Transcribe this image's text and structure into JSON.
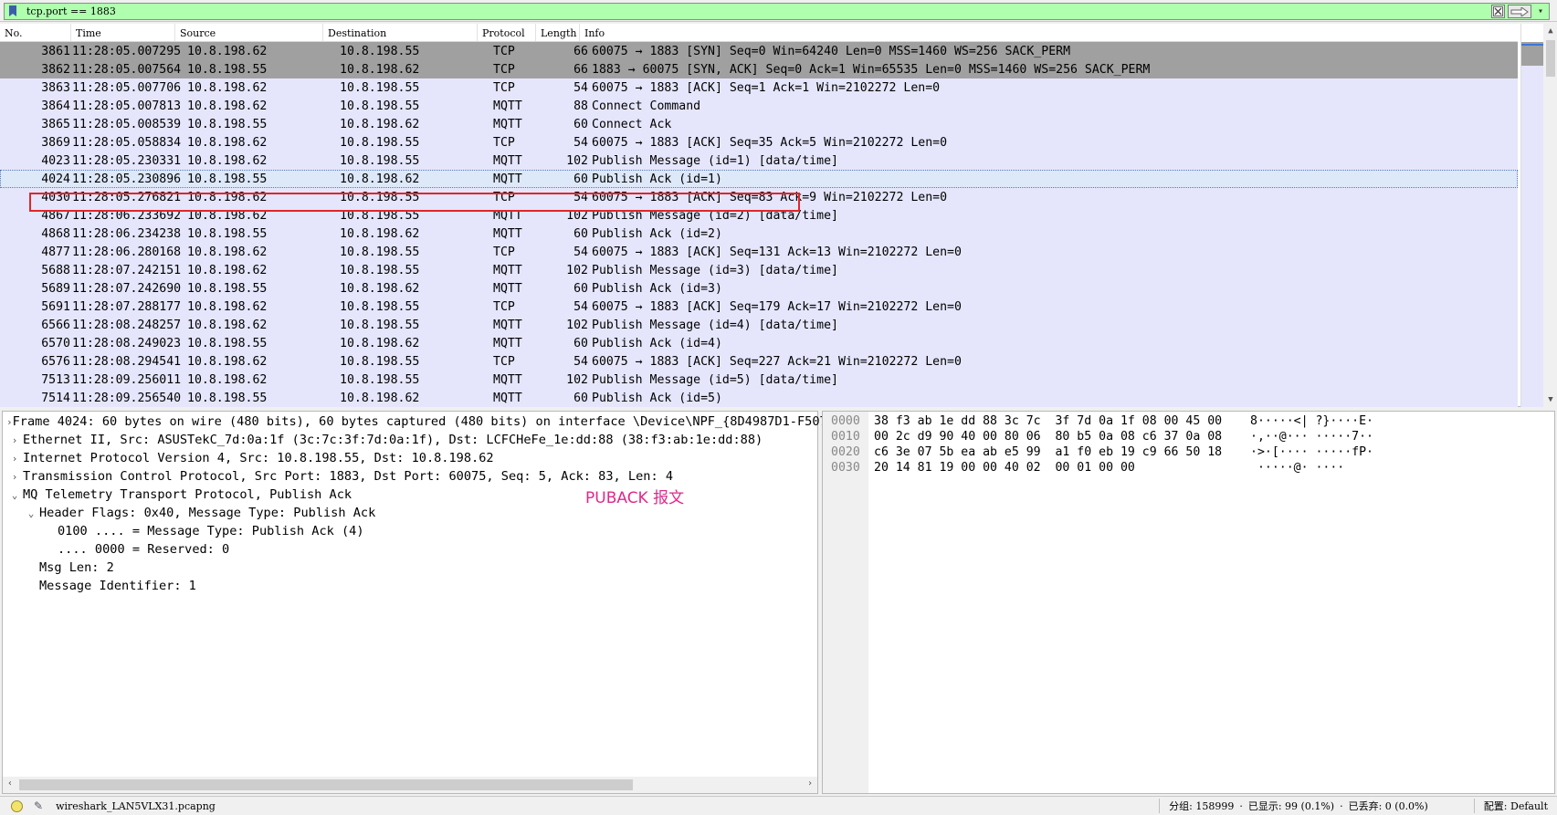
{
  "filter": {
    "value": "tcp.port == 1883"
  },
  "columns": {
    "no": "No.",
    "time": "Time",
    "source": "Source",
    "destination": "Destination",
    "protocol": "Protocol",
    "length": "Length",
    "info": "Info"
  },
  "packets": [
    {
      "no": "3861",
      "time": "11:28:05.007295",
      "src": "10.8.198.62",
      "dst": "10.8.198.55",
      "proto": "TCP",
      "len": "66",
      "info": "60075 → 1883 [SYN] Seq=0 Win=64240 Len=0 MSS=1460 WS=256 SACK_PERM"
    },
    {
      "no": "3862",
      "time": "11:28:05.007564",
      "src": "10.8.198.55",
      "dst": "10.8.198.62",
      "proto": "TCP",
      "len": "66",
      "info": "1883 → 60075 [SYN, ACK] Seq=0 Ack=1 Win=65535 Len=0 MSS=1460 WS=256 SACK_PERM"
    },
    {
      "no": "3863",
      "time": "11:28:05.007706",
      "src": "10.8.198.62",
      "dst": "10.8.198.55",
      "proto": "TCP",
      "len": "54",
      "info": "60075 → 1883 [ACK] Seq=1 Ack=1 Win=2102272 Len=0"
    },
    {
      "no": "3864",
      "time": "11:28:05.007813",
      "src": "10.8.198.62",
      "dst": "10.8.198.55",
      "proto": "MQTT",
      "len": "88",
      "info": "Connect Command"
    },
    {
      "no": "3865",
      "time": "11:28:05.008539",
      "src": "10.8.198.55",
      "dst": "10.8.198.62",
      "proto": "MQTT",
      "len": "60",
      "info": "Connect Ack"
    },
    {
      "no": "3869",
      "time": "11:28:05.058834",
      "src": "10.8.198.62",
      "dst": "10.8.198.55",
      "proto": "TCP",
      "len": "54",
      "info": "60075 → 1883 [ACK] Seq=35 Ack=5 Win=2102272 Len=0"
    },
    {
      "no": "4023",
      "time": "11:28:05.230331",
      "src": "10.8.198.62",
      "dst": "10.8.198.55",
      "proto": "MQTT",
      "len": "102",
      "info": "Publish Message (id=1) [data/time]"
    },
    {
      "no": "4024",
      "time": "11:28:05.230896",
      "src": "10.8.198.55",
      "dst": "10.8.198.62",
      "proto": "MQTT",
      "len": "60",
      "info": "Publish Ack (id=1)"
    },
    {
      "no": "4030",
      "time": "11:28:05.276821",
      "src": "10.8.198.62",
      "dst": "10.8.198.55",
      "proto": "TCP",
      "len": "54",
      "info": "60075 → 1883 [ACK] Seq=83 Ack=9 Win=2102272 Len=0"
    },
    {
      "no": "4867",
      "time": "11:28:06.233692",
      "src": "10.8.198.62",
      "dst": "10.8.198.55",
      "proto": "MQTT",
      "len": "102",
      "info": "Publish Message (id=2) [data/time]"
    },
    {
      "no": "4868",
      "time": "11:28:06.234238",
      "src": "10.8.198.55",
      "dst": "10.8.198.62",
      "proto": "MQTT",
      "len": "60",
      "info": "Publish Ack (id=2)"
    },
    {
      "no": "4877",
      "time": "11:28:06.280168",
      "src": "10.8.198.62",
      "dst": "10.8.198.55",
      "proto": "TCP",
      "len": "54",
      "info": "60075 → 1883 [ACK] Seq=131 Ack=13 Win=2102272 Len=0"
    },
    {
      "no": "5688",
      "time": "11:28:07.242151",
      "src": "10.8.198.62",
      "dst": "10.8.198.55",
      "proto": "MQTT",
      "len": "102",
      "info": "Publish Message (id=3) [data/time]"
    },
    {
      "no": "5689",
      "time": "11:28:07.242690",
      "src": "10.8.198.55",
      "dst": "10.8.198.62",
      "proto": "MQTT",
      "len": "60",
      "info": "Publish Ack (id=3)"
    },
    {
      "no": "5691",
      "time": "11:28:07.288177",
      "src": "10.8.198.62",
      "dst": "10.8.198.55",
      "proto": "TCP",
      "len": "54",
      "info": "60075 → 1883 [ACK] Seq=179 Ack=17 Win=2102272 Len=0"
    },
    {
      "no": "6566",
      "time": "11:28:08.248257",
      "src": "10.8.198.62",
      "dst": "10.8.198.55",
      "proto": "MQTT",
      "len": "102",
      "info": "Publish Message (id=4) [data/time]"
    },
    {
      "no": "6570",
      "time": "11:28:08.249023",
      "src": "10.8.198.55",
      "dst": "10.8.198.62",
      "proto": "MQTT",
      "len": "60",
      "info": "Publish Ack (id=4)"
    },
    {
      "no": "6576",
      "time": "11:28:08.294541",
      "src": "10.8.198.62",
      "dst": "10.8.198.55",
      "proto": "TCP",
      "len": "54",
      "info": "60075 → 1883 [ACK] Seq=227 Ack=21 Win=2102272 Len=0"
    },
    {
      "no": "7513",
      "time": "11:28:09.256011",
      "src": "10.8.198.62",
      "dst": "10.8.198.55",
      "proto": "MQTT",
      "len": "102",
      "info": "Publish Message (id=5) [data/time]"
    },
    {
      "no": "7514",
      "time": "11:28:09.256540",
      "src": "10.8.198.55",
      "dst": "10.8.198.62",
      "proto": "MQTT",
      "len": "60",
      "info": "Publish Ack (id=5)"
    }
  ],
  "selected_packet": "4024",
  "details": [
    {
      "indent": 0,
      "arrow": "›",
      "text": "Frame 4024: 60 bytes on wire (480 bits), 60 bytes captured (480 bits) on interface \\Device\\NPF_{8D4987D1-F507"
    },
    {
      "indent": 0,
      "arrow": "›",
      "text": "Ethernet II, Src: ASUSTekC_7d:0a:1f (3c:7c:3f:7d:0a:1f), Dst: LCFCHeFe_1e:dd:88 (38:f3:ab:1e:dd:88)"
    },
    {
      "indent": 0,
      "arrow": "›",
      "text": "Internet Protocol Version 4, Src: 10.8.198.55, Dst: 10.8.198.62"
    },
    {
      "indent": 0,
      "arrow": "›",
      "text": "Transmission Control Protocol, Src Port: 1883, Dst Port: 60075, Seq: 5, Ack: 83, Len: 4"
    },
    {
      "indent": 0,
      "arrow": "⌄",
      "text": "MQ Telemetry Transport Protocol, Publish Ack"
    },
    {
      "indent": 1,
      "arrow": "⌄",
      "text": "Header Flags: 0x40, Message Type: Publish Ack"
    },
    {
      "indent": 2,
      "arrow": "",
      "text": "0100 .... = Message Type: Publish Ack (4)"
    },
    {
      "indent": 2,
      "arrow": "",
      "text": ".... 0000 = Reserved: 0"
    },
    {
      "indent": 1,
      "arrow": "",
      "text": "Msg Len: 2"
    },
    {
      "indent": 1,
      "arrow": "",
      "text": "Message Identifier: 1"
    }
  ],
  "annotation": "PUBACK 报文",
  "bytes": [
    {
      "off": "0000",
      "hex": "38 f3 ab 1e dd 88 3c 7c  3f 7d 0a 1f 08 00 45 00",
      "asc": "8·····<| ?}····E·"
    },
    {
      "off": "0010",
      "hex": "00 2c d9 90 40 00 80 06  80 b5 0a 08 c6 37 0a 08",
      "asc": "·,··@··· ·····7··"
    },
    {
      "off": "0020",
      "hex": "c6 3e 07 5b ea ab e5 99  a1 f0 eb 19 c9 66 50 18",
      "asc": "·>·[···· ·····fP·"
    },
    {
      "off": "0030",
      "hex": "20 14 81 19 00 00 40 02  00 01 00 00",
      "asc": " ·····@· ····"
    }
  ],
  "status": {
    "file": "wireshark_LAN5VLX31.pcapng",
    "packets": "分组: 158999",
    "displayed": "已显示: 99 (0.1%)",
    "dropped": "已丢弃: 0 (0.0%)",
    "profile": "配置: Default"
  }
}
